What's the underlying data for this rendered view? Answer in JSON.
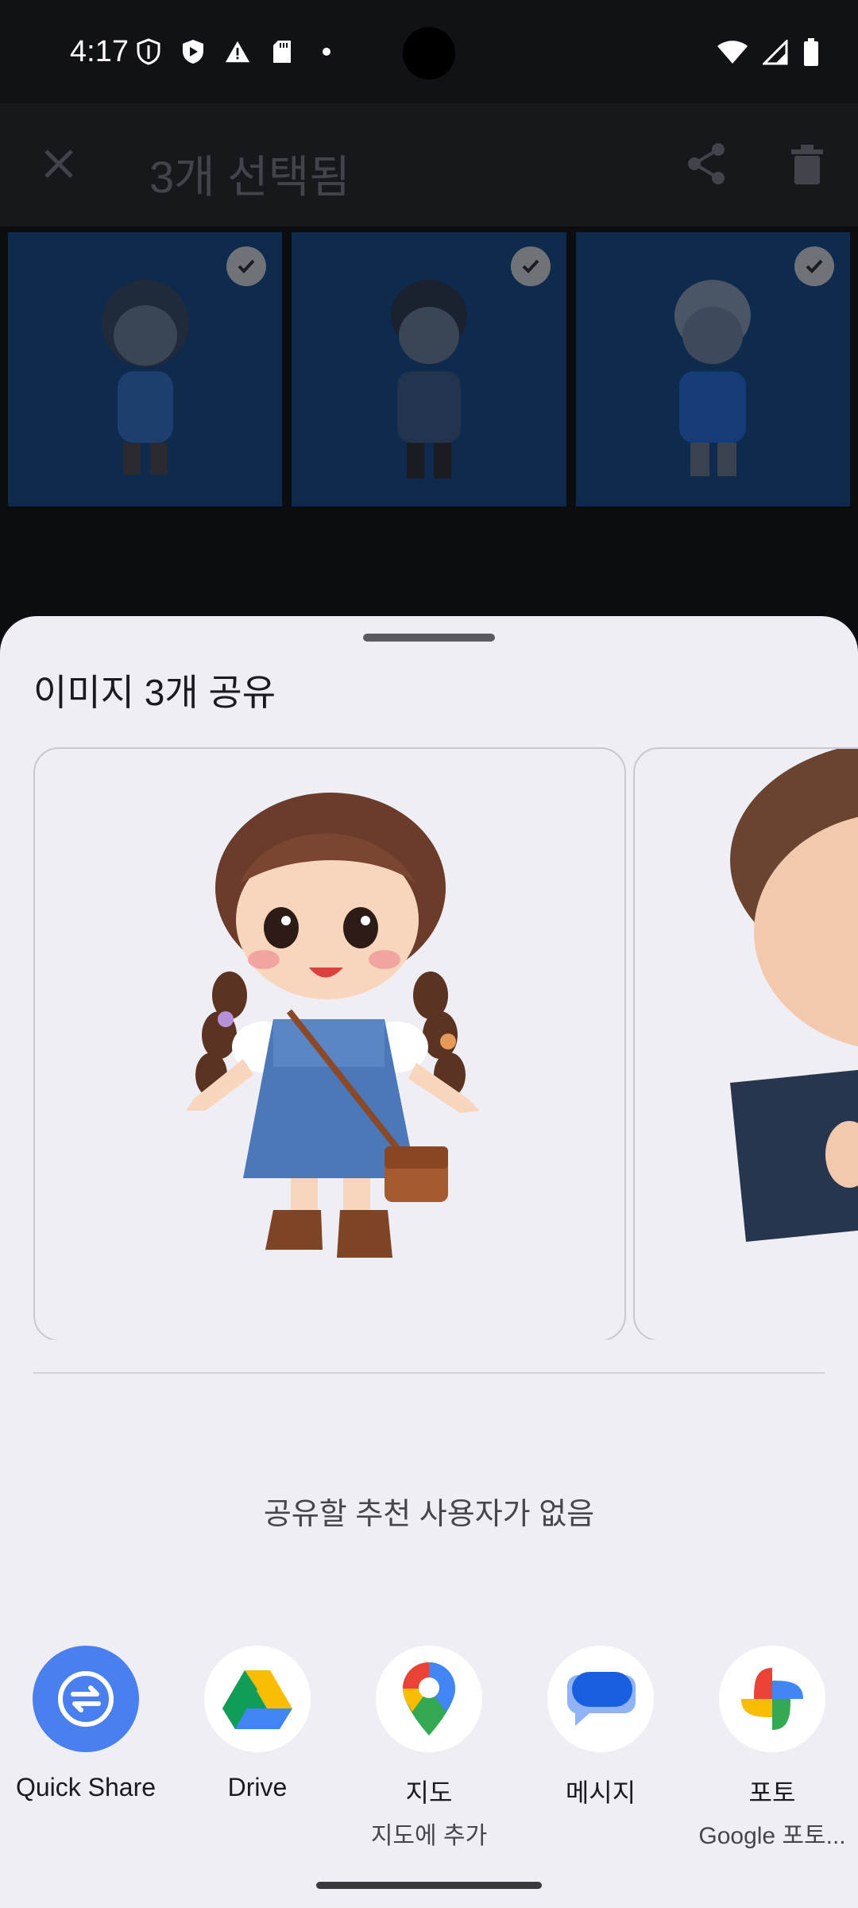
{
  "status_bar": {
    "time": "4:17",
    "left_icons": [
      "shield-outline-icon",
      "play-shield-icon",
      "warning-icon",
      "sd-card-icon",
      "dot-icon"
    ],
    "right_icons": [
      "wifi-icon",
      "signal-icon",
      "battery-icon"
    ]
  },
  "app_bar": {
    "title": "3개 선택됨",
    "icons": [
      "close-icon",
      "share-icon",
      "delete-icon"
    ]
  },
  "thumbnails": [
    {
      "selected": true,
      "subject": "girl"
    },
    {
      "selected": true,
      "subject": "boy"
    },
    {
      "selected": true,
      "subject": "blond-boy"
    }
  ],
  "share_sheet": {
    "title": "이미지 3개 공유",
    "no_suggestions": "공유할 추천 사용자가 없음",
    "apps": [
      {
        "label": "Quick Share",
        "sub": "",
        "icon": "quick-share-icon"
      },
      {
        "label": "Drive",
        "sub": "",
        "icon": "drive-icon"
      },
      {
        "label": "지도",
        "sub": "지도에 추가",
        "icon": "maps-pin-icon"
      },
      {
        "label": "메시지",
        "sub": "",
        "icon": "messages-icon"
      },
      {
        "label": "포토",
        "sub": "Google 포토...",
        "icon": "photos-pinwheel-icon"
      }
    ]
  },
  "colors": {
    "sheet_bg": "#f0eef5",
    "quick_share_blue": "#4a7ff0",
    "thumb_selected_bg": "#0e2a4c"
  }
}
